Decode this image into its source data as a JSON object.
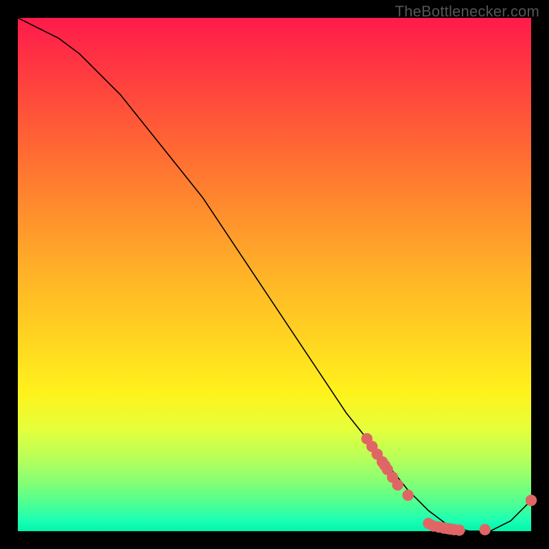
{
  "attribution": "TheBottlenecker.com",
  "chart_data": {
    "type": "line",
    "title": "",
    "xlabel": "",
    "ylabel": "",
    "xlim": [
      0,
      100
    ],
    "ylim": [
      0,
      100
    ],
    "series": [
      {
        "name": "bottleneck-curve",
        "x": [
          0,
          4,
          8,
          12,
          16,
          20,
          24,
          28,
          32,
          36,
          40,
          44,
          48,
          52,
          56,
          60,
          64,
          68,
          72,
          76,
          80,
          84,
          88,
          92,
          96,
          100
        ],
        "y": [
          100,
          98,
          96,
          93,
          89,
          85,
          80,
          75,
          70,
          65,
          59,
          53,
          47,
          41,
          35,
          29,
          23,
          18,
          13,
          8,
          4,
          1,
          0,
          0,
          2,
          6
        ]
      }
    ],
    "markers": [
      {
        "name": "highlight-points",
        "color": "#e06666",
        "radius_plot_units": 1.1,
        "points": [
          [
            68,
            18
          ],
          [
            69,
            16.5
          ],
          [
            70,
            15
          ],
          [
            71,
            13.5
          ],
          [
            71.5,
            12.8
          ],
          [
            72,
            12
          ],
          [
            73,
            10.5
          ],
          [
            74,
            9
          ],
          [
            76,
            7
          ],
          [
            80,
            1.5
          ],
          [
            81,
            1
          ],
          [
            82,
            0.8
          ],
          [
            83,
            0.6
          ],
          [
            83.7,
            0.5
          ],
          [
            84.3,
            0.4
          ],
          [
            85,
            0.3
          ],
          [
            86,
            0.2
          ],
          [
            91,
            0.3
          ],
          [
            100,
            6
          ]
        ]
      }
    ]
  }
}
